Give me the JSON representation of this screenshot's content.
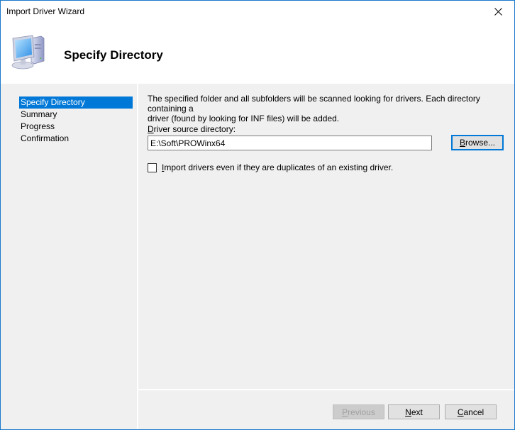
{
  "window": {
    "title": "Import Driver Wizard",
    "close_icon": "close-icon"
  },
  "header": {
    "icon": "computer-icon",
    "title": "Specify Directory"
  },
  "sidebar": {
    "items": [
      {
        "label": "Specify Directory",
        "active": true
      },
      {
        "label": "Summary",
        "active": false
      },
      {
        "label": "Progress",
        "active": false
      },
      {
        "label": "Confirmation",
        "active": false
      }
    ]
  },
  "main": {
    "description_line1": "The specified folder and all subfolders will be scanned looking for drivers.  Each directory containing a",
    "description_line2": "driver (found by looking for INF files) will be added.",
    "source_label_accel": "D",
    "source_label_rest": "river source directory:",
    "source_value": "E:\\Soft\\PROWinx64",
    "browse_accel": "B",
    "browse_rest": "rowse...",
    "duplicates_accel": "I",
    "duplicates_rest": "mport drivers even if they are duplicates of an existing driver.",
    "duplicates_checked": false
  },
  "footer": {
    "previous_accel": "P",
    "previous_rest": "revious",
    "next_accel": "N",
    "next_rest": "ext",
    "cancel_accel": "C",
    "cancel_rest": "ancel"
  },
  "colors": {
    "accent": "#0078d7",
    "window_border": "#1979ca",
    "panel_bg": "#f0f0f0"
  }
}
